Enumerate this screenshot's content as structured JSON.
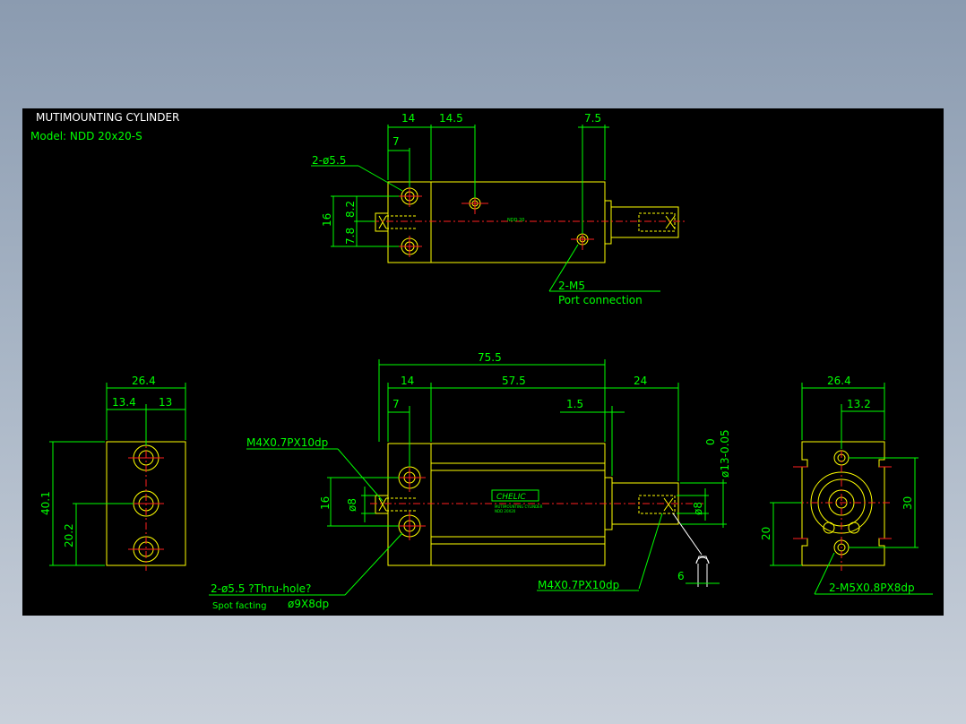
{
  "title": "MUTIMOUNTING CYLINDER",
  "model": "Model: NDD 20x20-S",
  "colors": {
    "background": "#000000",
    "outline": "#ffff00",
    "dimension": "#00ff00",
    "centerline": "#ff2020",
    "title_text": "#ffffff"
  },
  "top_view": {
    "dims": {
      "d14": "14",
      "d14_5": "14.5",
      "d7_5": "7.5",
      "d7": "7",
      "d16": "16",
      "d7_8": "7.8",
      "d8_2": "8.2"
    },
    "hole_note": "2-ø5.5",
    "port_note": "2-M5",
    "port_desc": "Port connection",
    "nameplate": "NDD 20"
  },
  "left_view": {
    "dims": {
      "width": "26.4",
      "half_left": "13.4",
      "half_right": "13",
      "height": "40.1",
      "mid": "20.2"
    }
  },
  "front_view": {
    "dims": {
      "overall": "75.5",
      "d14": "14",
      "d57_5": "57.5",
      "d24": "24",
      "d7": "7",
      "d1_5": "1.5",
      "d16": "16",
      "d8_left": "ø8",
      "d8_right": "ø8",
      "tol_upper": "0",
      "rod_dia": "ø13-0.05",
      "d6": "6"
    },
    "thread_left": "M4X0.7PX10dp",
    "thread_right": "M4X0.7PX10dp",
    "hole_note": "2-ø5.5 ?Thru-hole?",
    "spot_label": "Spot facting",
    "spot_value": "ø9X8dp",
    "logo": "CHELIC",
    "plate_line1": "MUTIMOUNTING CYLINDER",
    "plate_line2": "NDD 20X20"
  },
  "right_view": {
    "dims": {
      "width": "26.4",
      "half": "13.2",
      "height30": "30",
      "height20": "20"
    },
    "thread_note": "2-M5X0.8PX8dp"
  }
}
